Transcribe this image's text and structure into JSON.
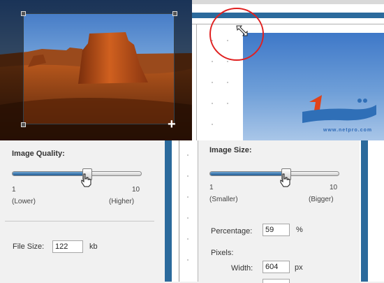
{
  "photo": {
    "icons": {
      "crop_handle": "crop-handle",
      "move_cursor": "plus-cursor"
    },
    "cursor_glyph": "+"
  },
  "canvas": {
    "logo_text": "www.netpro.com"
  },
  "quality": {
    "heading": "Image Quality:",
    "min_value": "1",
    "max_value": "10",
    "min_hint": "(Lower)",
    "max_hint": "(Higher)",
    "level": 0.58,
    "file_size_label": "File Size:",
    "file_size_value": "122",
    "file_size_unit": "kb"
  },
  "size": {
    "heading": "Image Size:",
    "min_value": "1",
    "max_value": "10",
    "min_hint": "(Smaller)",
    "max_hint": "(Bigger)",
    "level": 0.59,
    "percentage_label": "Percentage:",
    "percentage_value": "59",
    "percentage_unit": "%",
    "pixels_label": "Pixels:",
    "width_label": "Width:",
    "width_value": "604",
    "width_unit": "px"
  },
  "colors": {
    "accent": "#2b6a9c",
    "annotation": "#e02020",
    "slider_fill": "#1f5a93"
  }
}
